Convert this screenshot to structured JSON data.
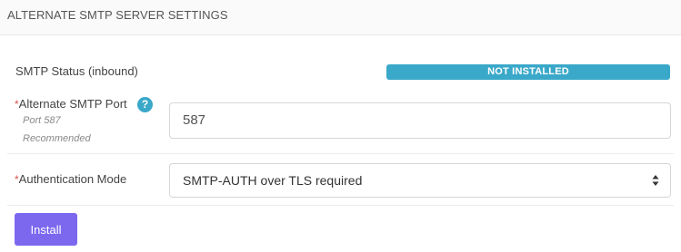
{
  "panel": {
    "title": "ALTERNATE SMTP SERVER SETTINGS"
  },
  "status_row": {
    "label": "SMTP Status (inbound)",
    "badge": "NOT INSTALLED",
    "badge_color": "#3aa8c9"
  },
  "port_row": {
    "required_mark": "*",
    "label": "Alternate SMTP Port",
    "help_icon": "question-circle-icon",
    "hint_line1": "Port 587",
    "hint_line2": "Recommended",
    "value": "587"
  },
  "auth_row": {
    "required_mark": "*",
    "label": "Authentication Mode",
    "selected": "SMTP-AUTH over TLS required"
  },
  "actions": {
    "install_label": "Install",
    "install_color": "#7b68ee"
  }
}
